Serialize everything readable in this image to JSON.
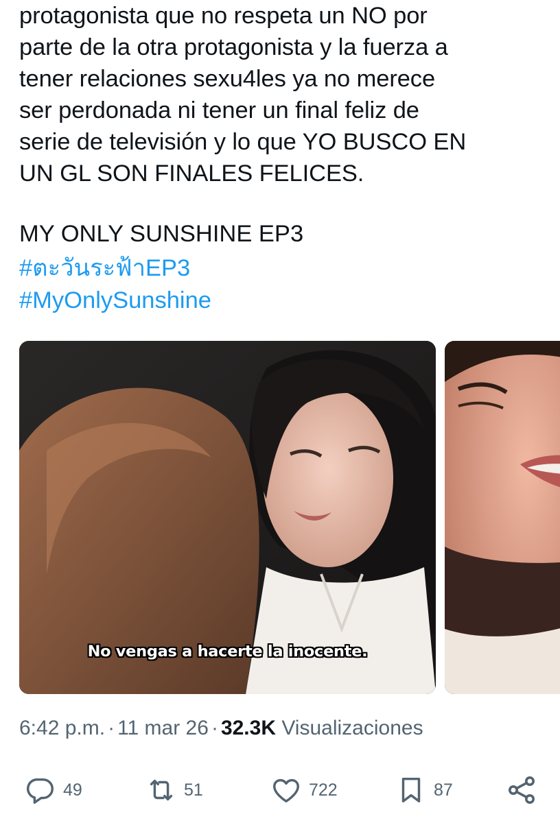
{
  "tweet": {
    "body_lines": [
      "protagonista que no respeta un NO por",
      "parte de la otra protagonista y la fuerza a",
      "tener relaciones sexu4les ya no merece",
      "ser perdonada ni tener un final feliz de",
      "serie de televisión y lo que YO BUSCO EN",
      "UN GL SON FINALES FELICES."
    ],
    "episode_line": "MY ONLY SUNSHINE EP3",
    "hashtags": [
      "#ตะวันระฟ้าEP3",
      "#MyOnlySunshine"
    ]
  },
  "media": {
    "subtitle": "No vengas a hacerte la inocente."
  },
  "meta": {
    "time": "6:42 p.m.",
    "date": "11 mar 26",
    "separator": "·",
    "views_count": "32.3K",
    "views_label": "Visualizaciones"
  },
  "actions": {
    "reply_count": "49",
    "repost_count": "51",
    "like_count": "722",
    "bookmark_count": "87"
  },
  "icons": {
    "reply": "reply-icon",
    "repost": "repost-icon",
    "like": "heart-icon",
    "bookmark": "bookmark-icon",
    "share": "share-icon"
  },
  "colors": {
    "text": "#0f1419",
    "secondary": "#536471",
    "link": "#1d9bf0"
  }
}
